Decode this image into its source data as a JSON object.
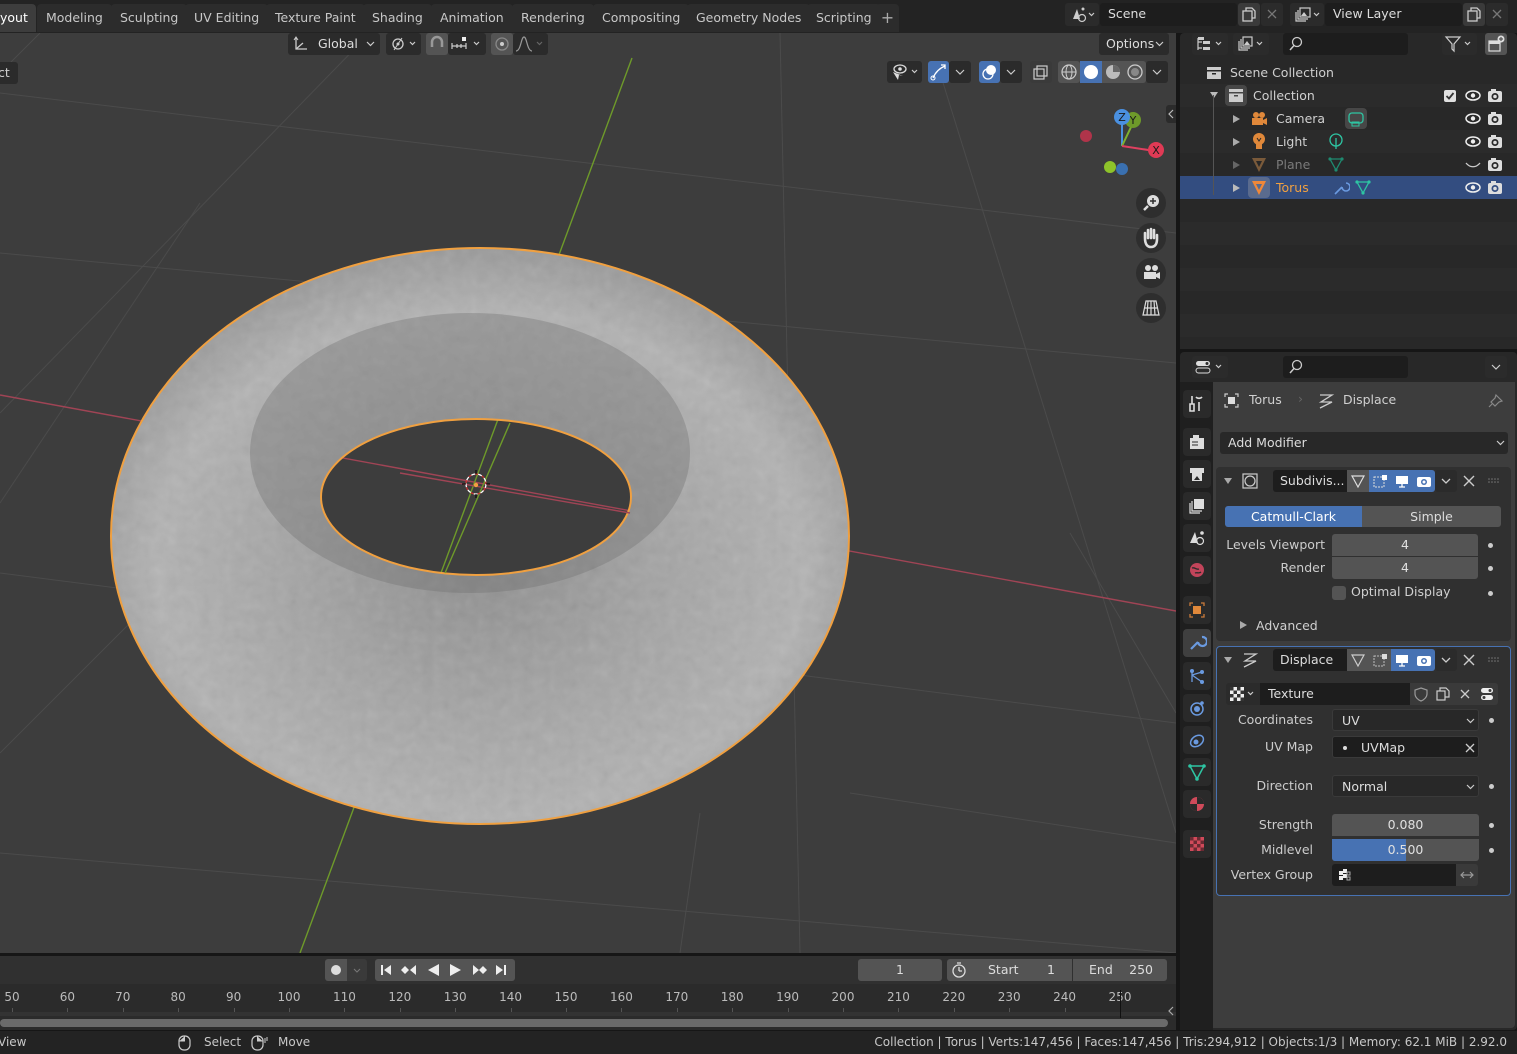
{
  "workspace_tabs": [
    {
      "label": "Layout",
      "visible_label": "yout",
      "active": true
    },
    {
      "label": "Modeling"
    },
    {
      "label": "Sculpting"
    },
    {
      "label": "UV Editing"
    },
    {
      "label": "Texture Paint"
    },
    {
      "label": "Shading"
    },
    {
      "label": "Animation"
    },
    {
      "label": "Rendering"
    },
    {
      "label": "Compositing"
    },
    {
      "label": "Geometry Nodes"
    },
    {
      "label": "Scripting"
    }
  ],
  "add_workspace_label": "+",
  "scene": {
    "name": "Scene"
  },
  "view_layer": {
    "name": "View Layer"
  },
  "viewport": {
    "header": {
      "transform_orientation": "Global",
      "options_label": "Options"
    },
    "mode_partial_label": "ct",
    "gizmo": {
      "x_label": "X",
      "y_label": "Y",
      "z_label": "Z"
    },
    "colors": {
      "selection_outline": "#f0a040",
      "x_axis": "#e04060",
      "y_axis": "#7eb030",
      "mesh": "#a8a8a8"
    }
  },
  "outliner": {
    "search_placeholder": "",
    "items": [
      {
        "label": "Scene Collection",
        "type": "scene-collection"
      },
      {
        "label": "Collection",
        "type": "collection",
        "checked": true,
        "visible": true
      },
      {
        "label": "Camera",
        "type": "camera",
        "visible": true
      },
      {
        "label": "Light",
        "type": "light",
        "visible": true
      },
      {
        "label": "Plane",
        "type": "mesh",
        "visible": false,
        "dimmed": true
      },
      {
        "label": "Torus",
        "type": "mesh",
        "visible": true,
        "selected": true
      }
    ]
  },
  "properties": {
    "search_placeholder": "",
    "breadcrumb": {
      "object": "Torus",
      "modifier": "Displace"
    },
    "add_modifier_label": "Add Modifier",
    "tabs": [
      "tool",
      "render",
      "output",
      "view-layer",
      "scene",
      "world",
      "object",
      "modifiers",
      "particles",
      "physics",
      "constraints",
      "data",
      "material",
      "texture"
    ],
    "active_tab": "modifiers",
    "subdivision": {
      "name": "Subdivis...",
      "mode_options": [
        "Catmull-Clark",
        "Simple"
      ],
      "active_mode": "Catmull-Clark",
      "levels_viewport_label": "Levels Viewport",
      "levels_viewport": "4",
      "render_label": "Render",
      "render": "4",
      "optimal_display_label": "Optimal Display",
      "optimal_display": false,
      "advanced_label": "Advanced"
    },
    "displace": {
      "name": "Displace",
      "texture_label": "Texture",
      "coordinates_label": "Coordinates",
      "coordinates": "UV",
      "uv_map_label": "UV Map",
      "uv_map": "UVMap",
      "direction_label": "Direction",
      "direction": "Normal",
      "strength_label": "Strength",
      "strength": "0.080",
      "midlevel_label": "Midlevel",
      "midlevel": "0.500",
      "midlevel_fraction": 0.5,
      "vertex_group_label": "Vertex Group",
      "vertex_group": ""
    }
  },
  "timeline": {
    "current_frame": "1",
    "start_label": "Start",
    "start": "1",
    "end_label": "End",
    "end": "250",
    "ticks": [
      "50",
      "60",
      "70",
      "80",
      "90",
      "100",
      "110",
      "120",
      "130",
      "140",
      "150",
      "160",
      "170",
      "180",
      "190",
      "200",
      "210",
      "220",
      "230",
      "240",
      "250"
    ]
  },
  "status_bar": {
    "left_partial": "View",
    "select_label": "Select",
    "move_label": "Move",
    "stats": "Collection | Torus | Verts:147,456 | Faces:147,456 | Tris:294,912 | Objects:1/3 | Memory: 62.1 MiB | 2.92.0"
  },
  "colors": {
    "accent": "#4772b3",
    "selected_row": "#334d80",
    "object_orange": "#e0883a",
    "data_green": "#2ec5a3"
  }
}
